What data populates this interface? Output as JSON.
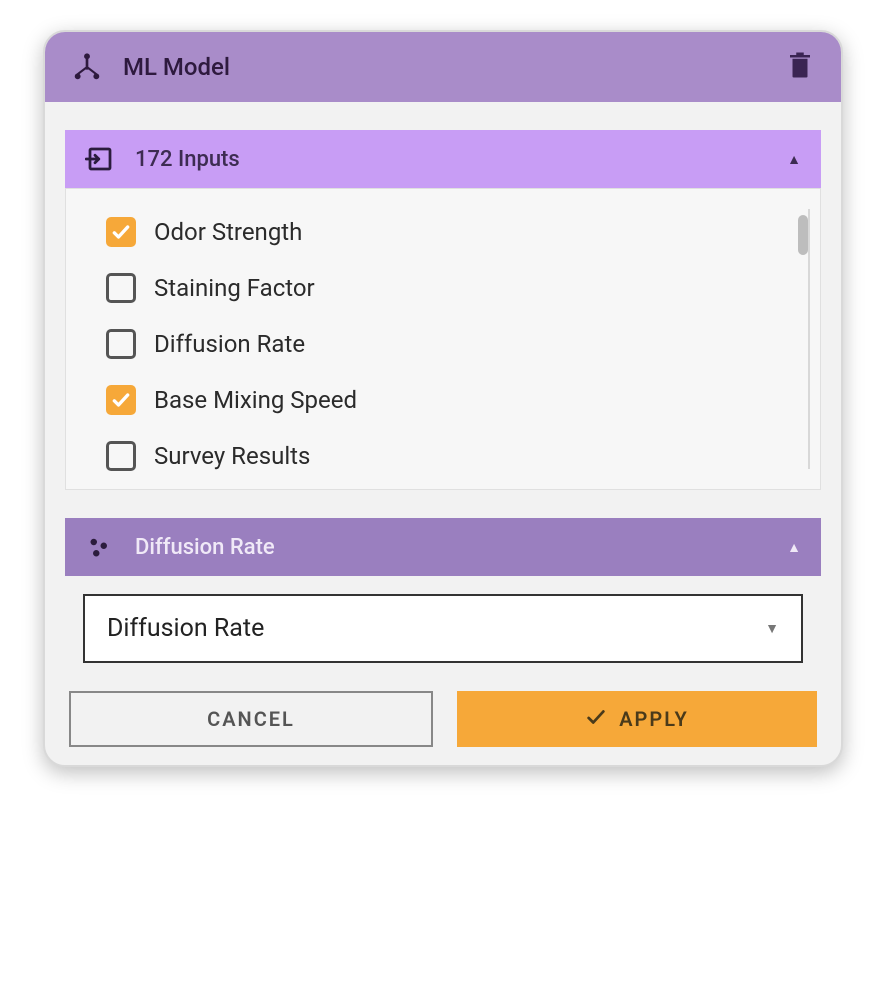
{
  "header": {
    "title": "ML Model"
  },
  "inputs_section": {
    "label": "172 Inputs",
    "items": [
      {
        "label": "Odor Strength",
        "checked": true
      },
      {
        "label": "Staining Factor",
        "checked": false
      },
      {
        "label": "Diffusion Rate",
        "checked": false
      },
      {
        "label": "Base Mixing Speed",
        "checked": true
      },
      {
        "label": "Survey Results",
        "checked": false
      }
    ]
  },
  "output_section": {
    "label": "Diffusion Rate",
    "selected": "Diffusion Rate"
  },
  "buttons": {
    "cancel": "CANCEL",
    "apply": "APPLY"
  }
}
